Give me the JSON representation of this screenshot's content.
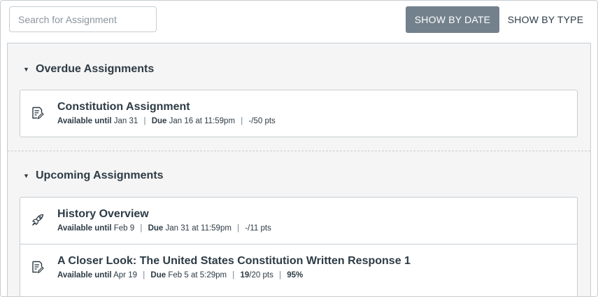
{
  "search": {
    "placeholder": "Search for Assignment"
  },
  "view_toggle": {
    "by_date_label": "SHOW BY DATE",
    "by_type_label": "SHOW BY TYPE",
    "active": "by_date",
    "active_color": "#73818c"
  },
  "groups": [
    {
      "title": "Overdue Assignments",
      "items": [
        {
          "icon": "assignment-icon",
          "title": "Constitution Assignment",
          "available_label": "Available until",
          "available_date": "Jan 31",
          "due_label": "Due",
          "due_date": "Jan 16 at 11:59pm",
          "points": "-/50 pts"
        }
      ]
    },
    {
      "title": "Upcoming Assignments",
      "items": [
        {
          "icon": "quiz-rocket-icon",
          "title": "History Overview",
          "available_label": "Available until",
          "available_date": "Feb 9",
          "due_label": "Due",
          "due_date": "Jan 31 at 11:59pm",
          "points": "-/11 pts"
        },
        {
          "icon": "assignment-icon",
          "title": "A Closer Look: The United States Constitution Written Response 1",
          "available_label": "Available until",
          "available_date": "Apr 19",
          "due_label": "Due",
          "due_date": "Feb 5 at 5:29pm",
          "score": "19",
          "points_suffix": "/20 pts",
          "percent": "95%"
        }
      ]
    }
  ]
}
